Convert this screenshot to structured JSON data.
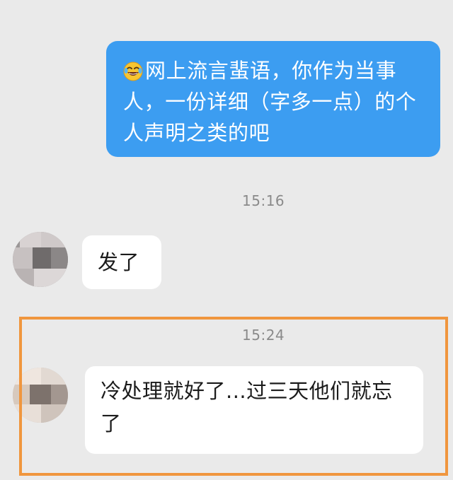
{
  "messages": [
    {
      "type": "outgoing",
      "emoji": "laughing-tears-emoji",
      "text": "网上流言蜚语，你作为当事人，一份详细（字多一点）的个人声明之类的吧"
    },
    {
      "type": "timestamp",
      "text": "15:16"
    },
    {
      "type": "incoming",
      "avatar": "blurred-avatar",
      "text": "发了"
    },
    {
      "type": "timestamp",
      "text": "15:24"
    },
    {
      "type": "incoming",
      "avatar": "blurred-avatar",
      "text": "冷处理就好了...过三天他们就忘了"
    }
  ],
  "colors": {
    "background": "#eaeaea",
    "outgoing_bubble": "#3c9df1",
    "incoming_bubble": "#ffffff",
    "highlight_border": "#f0963e",
    "timestamp_text": "#8a8a8a"
  }
}
